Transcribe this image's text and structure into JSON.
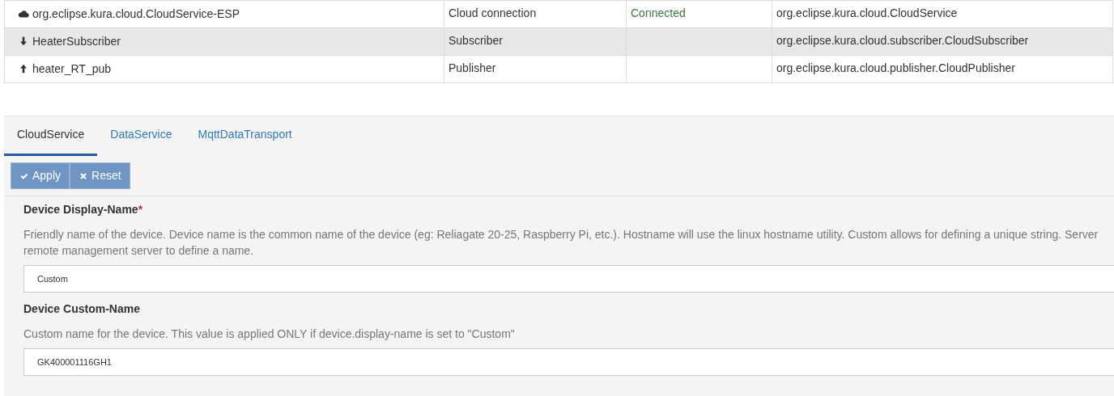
{
  "services": [
    {
      "kind": "cloud",
      "name": "org.eclipse.kura.cloud.CloudService-ESP",
      "type": "Cloud connection",
      "status": "Connected",
      "pid": "org.eclipse.kura.cloud.CloudService",
      "selected": false
    },
    {
      "kind": "down",
      "name": "HeaterSubscriber",
      "type": "Subscriber",
      "pid": "org.eclipse.kura.cloud.subscriber.CloudSubscriber",
      "selected": true
    },
    {
      "kind": "up",
      "name": "heater_RT_pub",
      "type": "Publisher",
      "pid": "org.eclipse.kura.cloud.publisher.CloudPublisher",
      "selected": false
    }
  ],
  "tabs": [
    {
      "label": "CloudService",
      "selected": true
    },
    {
      "label": "DataService",
      "selected": false
    },
    {
      "label": "MqttDataTransport",
      "selected": false
    }
  ],
  "buttons": [
    {
      "kind": "check",
      "label": "Apply"
    },
    {
      "kind": "cross",
      "label": "Reset"
    }
  ],
  "fields": [
    {
      "label": "Device Display-Name",
      "required_mark": "*",
      "description": "Friendly name of the device. Device name is the common name of the device (eg: Reliagate 20-25, Raspberry Pi, etc.). Hostname will use the linux hostname utility. Custom allows for defining a unique string. Server remote management server to define a name.",
      "value": "Custom"
    },
    {
      "label": "Device Custom-Name",
      "description": "Custom name for the device. This value is applied ONLY if device.display-name is set to \"Custom\"",
      "value": "GK400001116GH1"
    }
  ]
}
